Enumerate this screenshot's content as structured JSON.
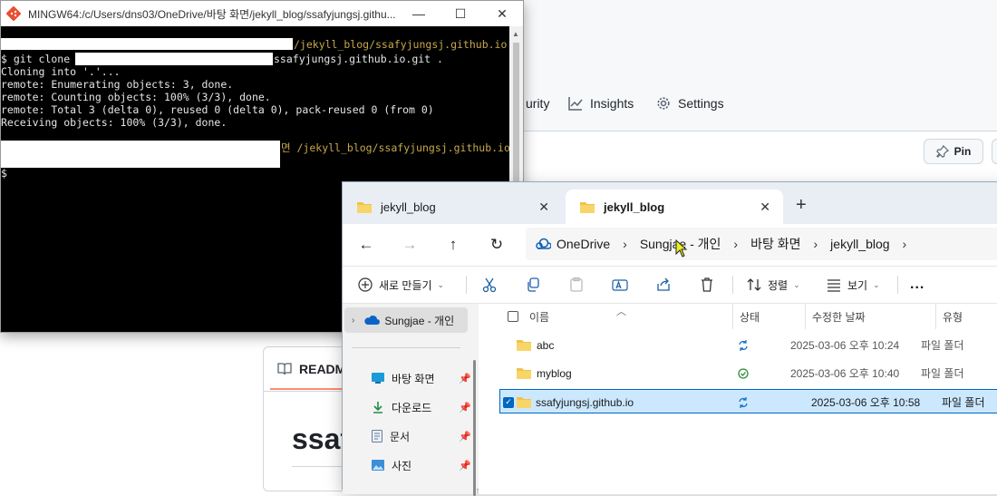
{
  "github": {
    "tabs": [
      {
        "label": "urity",
        "icon": "shield-icon"
      },
      {
        "label": "Insights",
        "icon": "graph-icon"
      },
      {
        "label": "Settings",
        "icon": "gear-icon"
      }
    ],
    "pin_label": "Pin",
    "readme_tab": "README",
    "repo_heading": "ssaf"
  },
  "terminal": {
    "title": "MINGW64:/c/Users/dns03/OneDrive/바탕 화면/jekyll_blog/ssafyjungsj.githu...",
    "lines": {
      "l1_path": "/jekyll_blog/ssafyjungsj.github.io",
      "l2_prefix": "$ git clone ",
      "l2_suffix": "ssafyjungsj.github.io.git .",
      "l3": "Cloning into '.'...",
      "l4": "remote: Enumerating objects: 3, done.",
      "l5": "remote: Counting objects: 100% (3/3), done.",
      "l6": "remote: Total 3 (delta 0), reused 0 (delta 0), pack-reused 0 (from 0)",
      "l7": "Receiving objects: 100% (3/3), done.",
      "l9_path": "면 /jekyll_blog/ssafyjungsj.github.io",
      "l10": "$ "
    }
  },
  "explorer": {
    "tabs": [
      {
        "label": "jekyll_blog"
      },
      {
        "label": "jekyll_blog"
      }
    ],
    "breadcrumb": [
      "OneDrive",
      "Sungjae - 개인",
      "바탕 화면",
      "jekyll_blog"
    ],
    "commands": {
      "new": "새로 만들기",
      "sort": "정렬",
      "view": "보기",
      "more": "..."
    },
    "nav": {
      "onedrive": "Sungjae - 개인",
      "items": [
        {
          "label": "바탕 화면",
          "icon": "desktop-icon"
        },
        {
          "label": "다운로드",
          "icon": "download-icon"
        },
        {
          "label": "문서",
          "icon": "document-icon"
        },
        {
          "label": "사진",
          "icon": "picture-icon"
        }
      ]
    },
    "columns": [
      "이름",
      "상태",
      "수정한 날짜",
      "유형"
    ],
    "rows": [
      {
        "name": "abc",
        "status": "sync",
        "date": "2025-03-06 오후 10:24",
        "type": "파일 폴더",
        "selected": false
      },
      {
        "name": "myblog",
        "status": "available",
        "date": "2025-03-06 오후 10:40",
        "type": "파일 폴더",
        "selected": false
      },
      {
        "name": "ssafyjungsj.github.io",
        "status": "sync",
        "date": "2025-03-06 오후 10:58",
        "type": "파일 폴더",
        "selected": true
      }
    ],
    "colors": {
      "folder": "#f2c14e",
      "accent": "#0067c0",
      "sync": "#1a73c8",
      "ok": "#2e8b3a"
    }
  }
}
